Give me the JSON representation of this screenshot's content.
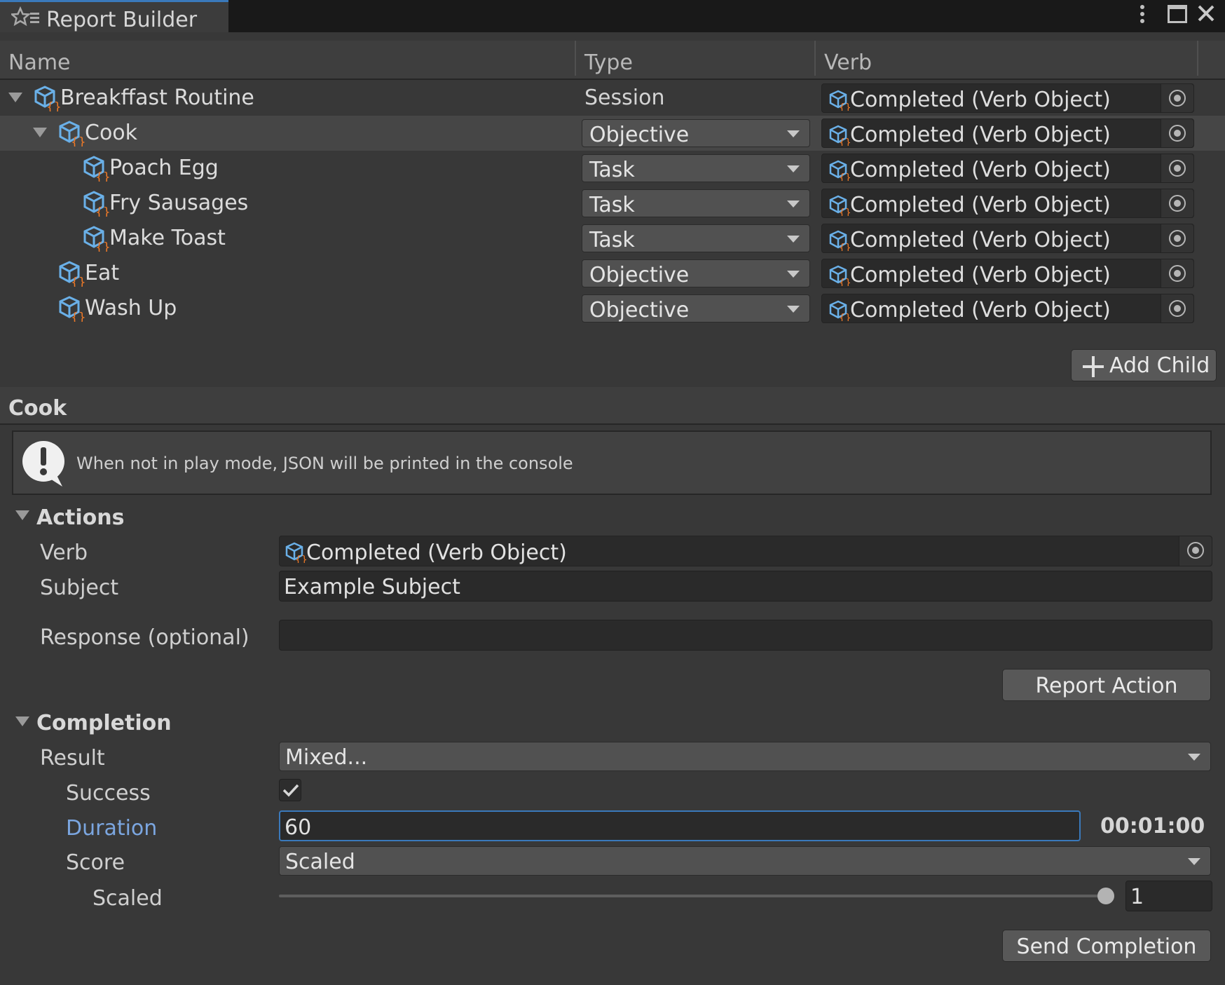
{
  "window": {
    "tab_title": "Report Builder"
  },
  "columns": {
    "name": "Name",
    "type": "Type",
    "verb": "Verb"
  },
  "tree": [
    {
      "name": "Breakffast Routine",
      "type": "Session",
      "verb": "Completed (Verb Object)"
    },
    {
      "name": "Cook",
      "type": "Objective",
      "verb": "Completed (Verb Object)"
    },
    {
      "name": "Poach Egg",
      "type": "Task",
      "verb": "Completed (Verb Object)"
    },
    {
      "name": "Fry Sausages",
      "type": "Task",
      "verb": "Completed (Verb Object)"
    },
    {
      "name": "Make Toast",
      "type": "Task",
      "verb": "Completed (Verb Object)"
    },
    {
      "name": "Eat",
      "type": "Objective",
      "verb": "Completed (Verb Object)"
    },
    {
      "name": "Wash Up",
      "type": "Objective",
      "verb": "Completed (Verb Object)"
    }
  ],
  "add_child_label": "Add Child",
  "inspector": {
    "title": "Cook",
    "help": "When not in play mode, JSON will be printed in the console",
    "actions": {
      "header": "Actions",
      "verb_label": "Verb",
      "verb_value": "Completed (Verb Object)",
      "subject_label": "Subject",
      "subject_value": "Example Subject",
      "response_label": "Response (optional)",
      "response_value": "",
      "report_button": "Report Action"
    },
    "completion": {
      "header": "Completion",
      "result_label": "Result",
      "result_value": "Mixed...",
      "success_label": "Success",
      "success_checked": true,
      "duration_label": "Duration",
      "duration_value": "60",
      "duration_formatted": "00:01:00",
      "score_label": "Score",
      "score_value": "Scaled",
      "scaled_label": "Scaled",
      "scaled_value": "1",
      "scaled_slider_fraction": 1.0,
      "send_button": "Send Completion"
    }
  },
  "colors": {
    "accent": "#3a79bb",
    "link_label": "#7ba6e0",
    "background": "#383838"
  }
}
